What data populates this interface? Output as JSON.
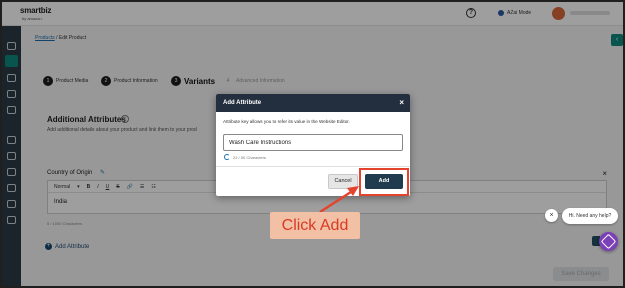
{
  "topbar": {
    "logo": "smartbiz",
    "logo_sub": "by amazon",
    "help_icon": "?",
    "ai_mode_label": "AZai Mode"
  },
  "breadcrumb": {
    "parent": "Products",
    "separator": "/",
    "current": "Edit Product"
  },
  "steps": [
    {
      "num": "1",
      "label": "Product Media"
    },
    {
      "num": "2",
      "label": "Product Information"
    },
    {
      "num": "3",
      "label": "Variants"
    },
    {
      "num": "4",
      "label": "Advanced Information"
    }
  ],
  "additional_attributes": {
    "title": "Additional Attributes",
    "info_icon": "i",
    "description": "Add additional details about your product and link them to your prod",
    "close": "×",
    "country_label": "Country of Origin",
    "toolbar": {
      "style": "Normal",
      "bold": "B",
      "italic": "I",
      "underline": "U",
      "strike": "S",
      "link": "🔗",
      "list1": "☰",
      "list2": "☷"
    },
    "value": "India",
    "char_count": "5 / 1000 Characters",
    "add_label": "Add Attribute",
    "add_icon": "+"
  },
  "save_button": "Save Changes",
  "modal": {
    "title": "Add Attribute",
    "close": "×",
    "description": "Attribute key allows you to refer its value in the Website Editor.",
    "input_value": "Wash Care Instructions",
    "char_count": "22 / 50 Characters",
    "cancel": "Cancel",
    "add": "Add"
  },
  "callout": "Click Add",
  "chat": {
    "close": "×",
    "bubble": "Hi. Need any help?"
  },
  "colors": {
    "sidebar": "#2b3a44",
    "accent_teal": "#0e8a7e",
    "modal_header": "#232f3e",
    "add_button": "#1f3b4d",
    "highlight": "#e4442e",
    "callout_bg": "#f2c0a5"
  }
}
